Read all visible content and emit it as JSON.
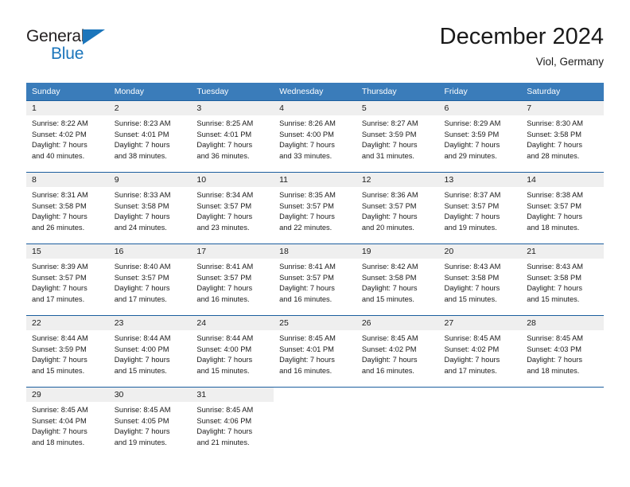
{
  "brand": {
    "name_part1": "General",
    "name_part2": "Blue",
    "logo_icon": "blue-triangle-icon"
  },
  "header": {
    "title": "December 2024",
    "location": "Viol, Germany"
  },
  "calendar": {
    "weekday_headers": [
      "Sunday",
      "Monday",
      "Tuesday",
      "Wednesday",
      "Thursday",
      "Friday",
      "Saturday"
    ],
    "colors": {
      "header_background": "#3a7cba",
      "header_text": "#ffffff",
      "row_divider": "#1b5e9e",
      "daynumber_band": "#efefef",
      "brand_blue": "#1b75bb",
      "text": "#1a1a1a"
    },
    "weeks": [
      [
        {
          "day": "1",
          "sunrise": "Sunrise: 8:22 AM",
          "sunset": "Sunset: 4:02 PM",
          "daylight1": "Daylight: 7 hours",
          "daylight2": "and 40 minutes."
        },
        {
          "day": "2",
          "sunrise": "Sunrise: 8:23 AM",
          "sunset": "Sunset: 4:01 PM",
          "daylight1": "Daylight: 7 hours",
          "daylight2": "and 38 minutes."
        },
        {
          "day": "3",
          "sunrise": "Sunrise: 8:25 AM",
          "sunset": "Sunset: 4:01 PM",
          "daylight1": "Daylight: 7 hours",
          "daylight2": "and 36 minutes."
        },
        {
          "day": "4",
          "sunrise": "Sunrise: 8:26 AM",
          "sunset": "Sunset: 4:00 PM",
          "daylight1": "Daylight: 7 hours",
          "daylight2": "and 33 minutes."
        },
        {
          "day": "5",
          "sunrise": "Sunrise: 8:27 AM",
          "sunset": "Sunset: 3:59 PM",
          "daylight1": "Daylight: 7 hours",
          "daylight2": "and 31 minutes."
        },
        {
          "day": "6",
          "sunrise": "Sunrise: 8:29 AM",
          "sunset": "Sunset: 3:59 PM",
          "daylight1": "Daylight: 7 hours",
          "daylight2": "and 29 minutes."
        },
        {
          "day": "7",
          "sunrise": "Sunrise: 8:30 AM",
          "sunset": "Sunset: 3:58 PM",
          "daylight1": "Daylight: 7 hours",
          "daylight2": "and 28 minutes."
        }
      ],
      [
        {
          "day": "8",
          "sunrise": "Sunrise: 8:31 AM",
          "sunset": "Sunset: 3:58 PM",
          "daylight1": "Daylight: 7 hours",
          "daylight2": "and 26 minutes."
        },
        {
          "day": "9",
          "sunrise": "Sunrise: 8:33 AM",
          "sunset": "Sunset: 3:58 PM",
          "daylight1": "Daylight: 7 hours",
          "daylight2": "and 24 minutes."
        },
        {
          "day": "10",
          "sunrise": "Sunrise: 8:34 AM",
          "sunset": "Sunset: 3:57 PM",
          "daylight1": "Daylight: 7 hours",
          "daylight2": "and 23 minutes."
        },
        {
          "day": "11",
          "sunrise": "Sunrise: 8:35 AM",
          "sunset": "Sunset: 3:57 PM",
          "daylight1": "Daylight: 7 hours",
          "daylight2": "and 22 minutes."
        },
        {
          "day": "12",
          "sunrise": "Sunrise: 8:36 AM",
          "sunset": "Sunset: 3:57 PM",
          "daylight1": "Daylight: 7 hours",
          "daylight2": "and 20 minutes."
        },
        {
          "day": "13",
          "sunrise": "Sunrise: 8:37 AM",
          "sunset": "Sunset: 3:57 PM",
          "daylight1": "Daylight: 7 hours",
          "daylight2": "and 19 minutes."
        },
        {
          "day": "14",
          "sunrise": "Sunrise: 8:38 AM",
          "sunset": "Sunset: 3:57 PM",
          "daylight1": "Daylight: 7 hours",
          "daylight2": "and 18 minutes."
        }
      ],
      [
        {
          "day": "15",
          "sunrise": "Sunrise: 8:39 AM",
          "sunset": "Sunset: 3:57 PM",
          "daylight1": "Daylight: 7 hours",
          "daylight2": "and 17 minutes."
        },
        {
          "day": "16",
          "sunrise": "Sunrise: 8:40 AM",
          "sunset": "Sunset: 3:57 PM",
          "daylight1": "Daylight: 7 hours",
          "daylight2": "and 17 minutes."
        },
        {
          "day": "17",
          "sunrise": "Sunrise: 8:41 AM",
          "sunset": "Sunset: 3:57 PM",
          "daylight1": "Daylight: 7 hours",
          "daylight2": "and 16 minutes."
        },
        {
          "day": "18",
          "sunrise": "Sunrise: 8:41 AM",
          "sunset": "Sunset: 3:57 PM",
          "daylight1": "Daylight: 7 hours",
          "daylight2": "and 16 minutes."
        },
        {
          "day": "19",
          "sunrise": "Sunrise: 8:42 AM",
          "sunset": "Sunset: 3:58 PM",
          "daylight1": "Daylight: 7 hours",
          "daylight2": "and 15 minutes."
        },
        {
          "day": "20",
          "sunrise": "Sunrise: 8:43 AM",
          "sunset": "Sunset: 3:58 PM",
          "daylight1": "Daylight: 7 hours",
          "daylight2": "and 15 minutes."
        },
        {
          "day": "21",
          "sunrise": "Sunrise: 8:43 AM",
          "sunset": "Sunset: 3:58 PM",
          "daylight1": "Daylight: 7 hours",
          "daylight2": "and 15 minutes."
        }
      ],
      [
        {
          "day": "22",
          "sunrise": "Sunrise: 8:44 AM",
          "sunset": "Sunset: 3:59 PM",
          "daylight1": "Daylight: 7 hours",
          "daylight2": "and 15 minutes."
        },
        {
          "day": "23",
          "sunrise": "Sunrise: 8:44 AM",
          "sunset": "Sunset: 4:00 PM",
          "daylight1": "Daylight: 7 hours",
          "daylight2": "and 15 minutes."
        },
        {
          "day": "24",
          "sunrise": "Sunrise: 8:44 AM",
          "sunset": "Sunset: 4:00 PM",
          "daylight1": "Daylight: 7 hours",
          "daylight2": "and 15 minutes."
        },
        {
          "day": "25",
          "sunrise": "Sunrise: 8:45 AM",
          "sunset": "Sunset: 4:01 PM",
          "daylight1": "Daylight: 7 hours",
          "daylight2": "and 16 minutes."
        },
        {
          "day": "26",
          "sunrise": "Sunrise: 8:45 AM",
          "sunset": "Sunset: 4:02 PM",
          "daylight1": "Daylight: 7 hours",
          "daylight2": "and 16 minutes."
        },
        {
          "day": "27",
          "sunrise": "Sunrise: 8:45 AM",
          "sunset": "Sunset: 4:02 PM",
          "daylight1": "Daylight: 7 hours",
          "daylight2": "and 17 minutes."
        },
        {
          "day": "28",
          "sunrise": "Sunrise: 8:45 AM",
          "sunset": "Sunset: 4:03 PM",
          "daylight1": "Daylight: 7 hours",
          "daylight2": "and 18 minutes."
        }
      ],
      [
        {
          "day": "29",
          "sunrise": "Sunrise: 8:45 AM",
          "sunset": "Sunset: 4:04 PM",
          "daylight1": "Daylight: 7 hours",
          "daylight2": "and 18 minutes."
        },
        {
          "day": "30",
          "sunrise": "Sunrise: 8:45 AM",
          "sunset": "Sunset: 4:05 PM",
          "daylight1": "Daylight: 7 hours",
          "daylight2": "and 19 minutes."
        },
        {
          "day": "31",
          "sunrise": "Sunrise: 8:45 AM",
          "sunset": "Sunset: 4:06 PM",
          "daylight1": "Daylight: 7 hours",
          "daylight2": "and 21 minutes."
        },
        {
          "day": "",
          "sunrise": "",
          "sunset": "",
          "daylight1": "",
          "daylight2": ""
        },
        {
          "day": "",
          "sunrise": "",
          "sunset": "",
          "daylight1": "",
          "daylight2": ""
        },
        {
          "day": "",
          "sunrise": "",
          "sunset": "",
          "daylight1": "",
          "daylight2": ""
        },
        {
          "day": "",
          "sunrise": "",
          "sunset": "",
          "daylight1": "",
          "daylight2": ""
        }
      ]
    ]
  }
}
